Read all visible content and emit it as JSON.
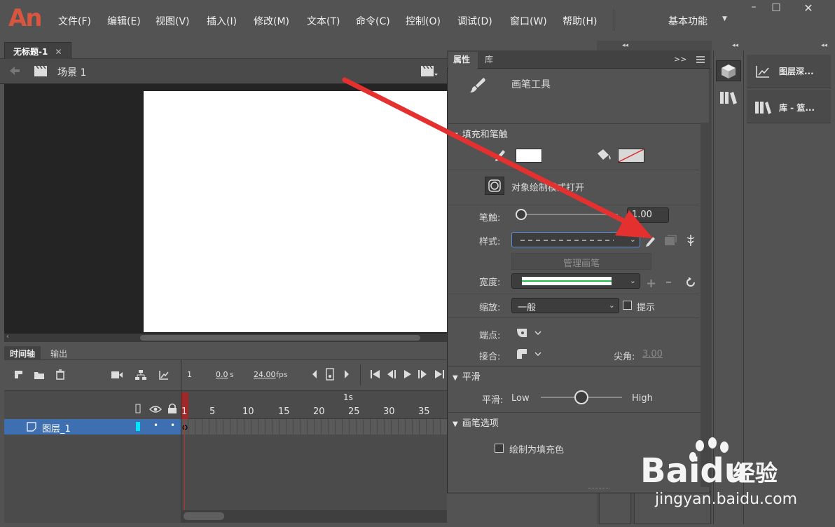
{
  "app": {
    "logo": "An"
  },
  "menu": [
    "文件(F)",
    "编辑(E)",
    "视图(V)",
    "插入(I)",
    "修改(M)",
    "文本(T)",
    "命令(C)",
    "控制(O)",
    "调试(D)",
    "窗口(W)",
    "帮助(H)"
  ],
  "workspace": {
    "label": "基本功能"
  },
  "window_controls": {
    "minimize": "–",
    "maximize": "□",
    "close": "✕"
  },
  "document": {
    "tab_title": "无标题-1",
    "tab_close": "✕",
    "scene": "场景 1"
  },
  "timeline": {
    "tabs": [
      "时间轴",
      "输出"
    ],
    "frame": "1",
    "time": "0.0",
    "time_unit": "s",
    "fps": "24.00",
    "fps_unit": "fps",
    "second_marker": "1s",
    "ruler": [
      "1",
      "5",
      "10",
      "15",
      "20",
      "25",
      "30",
      "35"
    ],
    "layer_name": "图层_1",
    "layer_marks": [
      "•",
      "•"
    ]
  },
  "properties": {
    "tabs": [
      "属性",
      "库"
    ],
    "tool_name": "画笔工具",
    "sections": {
      "fill_stroke": "填充和笔触",
      "smooth": "平滑",
      "brush_options": "画笔选项"
    },
    "object_drawing": "对象绘制模式打开",
    "stroke_label": "笔触:",
    "stroke_value": "1.00",
    "style_label": "样式:",
    "manage_brush": "管理画笔",
    "width_label": "宽度:",
    "scale_label": "缩放:",
    "scale_value": "一般",
    "hint_label": "提示",
    "cap_label": "端点:",
    "join_label": "接合:",
    "miter_label": "尖角:",
    "miter_value": "3.00",
    "smooth_label": "平滑:",
    "smooth_low": "Low",
    "smooth_high": "High",
    "smooth_level": 0.5,
    "draw_as_fill": "绘制为填充色"
  },
  "dock": {
    "items": [
      "图层深...",
      "库 - 篮..."
    ]
  },
  "watermark": {
    "brand": "Baidu",
    "cn": "经验",
    "url": "jingyan.baidu.com"
  },
  "colors": {
    "accent_blue": "#3e6fb0",
    "arrow_red": "#e53030",
    "cyan_layer": "#00e5ff"
  }
}
